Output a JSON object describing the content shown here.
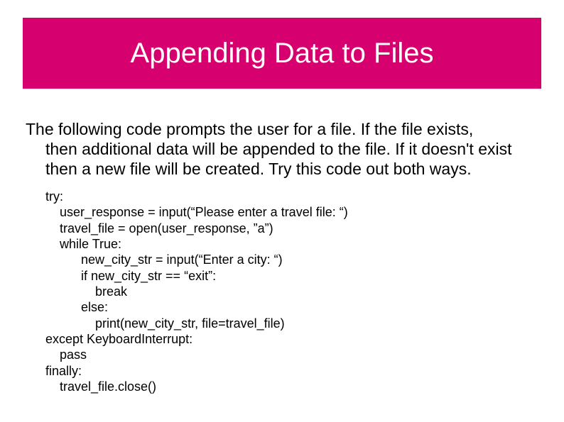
{
  "slide": {
    "title": "Appending Data to Files",
    "description_line1": "The following code prompts the user for a file.  If the file exists,",
    "description_line2": "then additional data will be appended to the file.  If it doesn't exist",
    "description_line3": "then a new file will be created.  Try this code out both ways.",
    "code": "try:\n    user_response = input(“Please enter a travel file: “)\n    travel_file = open(user_response, ”a”)\n    while True:\n          new_city_str = input(“Enter a city: “)\n          if new_city_str == “exit”:\n              break\n          else:\n              print(new_city_str, file=travel_file)\nexcept KeyboardInterrupt:\n    pass\nfinally:\n    travel_file.close()"
  }
}
